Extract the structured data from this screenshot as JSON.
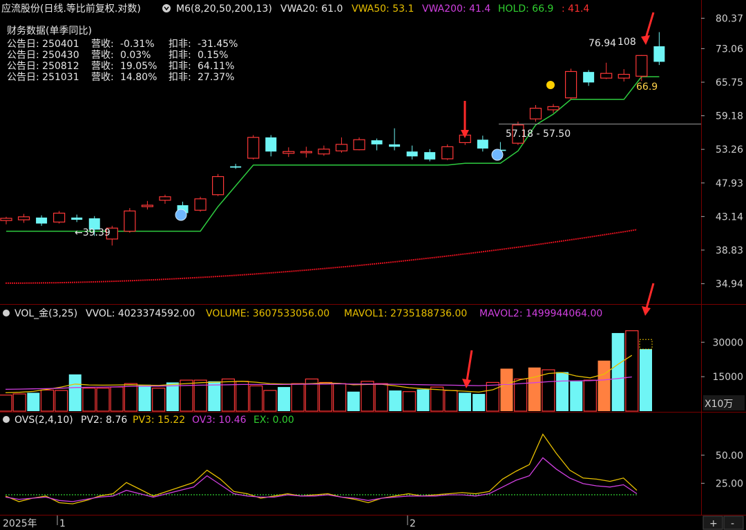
{
  "header": {
    "stock_name": "应流股份(日线.等比前复权.对数)",
    "indicator_name": "M6(8,20,50,200,13)",
    "indicators": [
      {
        "label": "VWA20: 61.0",
        "color": "#e8e8e8"
      },
      {
        "label": "VWA50: 53.1",
        "color": "#e8c000"
      },
      {
        "label": "VWA200: 41.4",
        "color": "#d040e0"
      },
      {
        "label": "HOLD: 66.9",
        "color": "#30d030"
      },
      {
        "label": ": 41.4",
        "color": "#ff3030"
      }
    ]
  },
  "fin_panel": {
    "title": "财务数据(单季同比)",
    "rows": [
      {
        "date": "公告日: 250401",
        "rev_label": "营收:",
        "rev": "-0.31%",
        "np_label": "扣非:",
        "np": "-31.45%"
      },
      {
        "date": "公告日: 250430",
        "rev_label": "营收:",
        "rev": "0.03%",
        "np_label": "扣非:",
        "np": "0.15%"
      },
      {
        "date": "公告日: 250812",
        "rev_label": "营收:",
        "rev": "19.05%",
        "np_label": "扣非:",
        "np": "64.11%"
      },
      {
        "date": "公告日: 251031",
        "rev_label": "营收:",
        "rev": "14.80%",
        "np_label": "扣非:",
        "np": "27.37%"
      }
    ]
  },
  "price_axis": [
    "80.37",
    "73.06",
    "65.75",
    "59.18",
    "53.26",
    "47.93",
    "43.14",
    "38.83",
    "34.94"
  ],
  "annotations": {
    "low": "←39.39",
    "high": "76.94",
    "high_suffix": "108",
    "range": "57.18 - 57.50",
    "hold": "66.9"
  },
  "vol_header": {
    "name": "VOL_金(3,25)",
    "items": [
      {
        "label": "VVOL: 4023374592.00",
        "color": "#e8e8e8"
      },
      {
        "label": "VOLUME: 3607533056.00",
        "color": "#e8c000"
      },
      {
        "label": "MAVOL1: 2735188736.00",
        "color": "#e8c000"
      },
      {
        "label": "MAVOL2: 1499944064.00",
        "color": "#d040e0"
      }
    ]
  },
  "vol_axis": [
    "30000",
    "15000"
  ],
  "vol_unit": "X10万",
  "ovs_header": {
    "name": "OVS(2,4,10)",
    "items": [
      {
        "label": "PV2: 8.76",
        "color": "#e8e8e8"
      },
      {
        "label": "PV3: 15.22",
        "color": "#e8c000"
      },
      {
        "label": "OV3: 10.46",
        "color": "#d040e0"
      },
      {
        "label": "EX: 0.00",
        "color": "#30d030"
      }
    ]
  },
  "ovs_axis": [
    "50.00",
    "25.00"
  ],
  "time_axis": {
    "year": "2025年",
    "m1": "1",
    "m2": "2"
  },
  "zoom": {
    "plus": "+",
    "minus": "-"
  },
  "colors": {
    "up": "#ff3838",
    "down": "#6ff5f5",
    "hold": "#2ecc40",
    "vwa200": "#e0101e",
    "vol_orange": "#ff8040"
  },
  "chart_data": [
    {
      "type": "candlestick",
      "title": "应流股份(日线.等比前复权.对数)",
      "scale": "log",
      "ylim": [
        33.5,
        84
      ],
      "candles": [
        {
          "o": 42.6,
          "h": 43.1,
          "l": 42.1,
          "c": 42.9
        },
        {
          "o": 42.7,
          "h": 43.5,
          "l": 42.3,
          "c": 43.1
        },
        {
          "o": 43.0,
          "h": 43.3,
          "l": 41.9,
          "c": 42.2
        },
        {
          "o": 42.4,
          "h": 43.9,
          "l": 42.2,
          "c": 43.6
        },
        {
          "o": 43.0,
          "h": 43.4,
          "l": 42.4,
          "c": 42.7
        },
        {
          "o": 42.9,
          "h": 43.2,
          "l": 40.6,
          "c": 41.4
        },
        {
          "o": 40.2,
          "h": 41.9,
          "l": 39.39,
          "c": 41.6
        },
        {
          "o": 41.2,
          "h": 44.3,
          "l": 41.0,
          "c": 43.9
        },
        {
          "o": 44.5,
          "h": 45.3,
          "l": 44.1,
          "c": 44.7
        },
        {
          "o": 45.4,
          "h": 46.2,
          "l": 44.9,
          "c": 45.9
        },
        {
          "o": 44.7,
          "h": 45.2,
          "l": 43.3,
          "c": 43.6
        },
        {
          "o": 44.0,
          "h": 45.9,
          "l": 43.8,
          "c": 45.6
        },
        {
          "o": 46.2,
          "h": 49.3,
          "l": 46.0,
          "c": 48.9
        },
        {
          "o": 50.5,
          "h": 50.9,
          "l": 50.1,
          "c": 50.3
        },
        {
          "o": 51.8,
          "h": 55.7,
          "l": 51.6,
          "c": 55.3
        },
        {
          "o": 55.3,
          "h": 55.7,
          "l": 52.1,
          "c": 52.9
        },
        {
          "o": 52.6,
          "h": 53.6,
          "l": 52.0,
          "c": 52.9
        },
        {
          "o": 52.7,
          "h": 53.7,
          "l": 51.9,
          "c": 52.9
        },
        {
          "o": 52.5,
          "h": 53.9,
          "l": 52.2,
          "c": 53.3
        },
        {
          "o": 53.0,
          "h": 55.3,
          "l": 52.7,
          "c": 54.1
        },
        {
          "o": 53.2,
          "h": 55.3,
          "l": 53.1,
          "c": 54.9
        },
        {
          "o": 54.8,
          "h": 55.1,
          "l": 53.1,
          "c": 54.1
        },
        {
          "o": 54.1,
          "h": 56.9,
          "l": 53.1,
          "c": 53.7
        },
        {
          "o": 52.9,
          "h": 53.9,
          "l": 51.6,
          "c": 52.1
        },
        {
          "o": 52.8,
          "h": 53.3,
          "l": 51.3,
          "c": 51.6
        },
        {
          "o": 51.7,
          "h": 54.1,
          "l": 51.5,
          "c": 53.7
        },
        {
          "o": 54.4,
          "h": 56.0,
          "l": 54.0,
          "c": 55.7
        },
        {
          "o": 54.9,
          "h": 55.6,
          "l": 52.9,
          "c": 53.4
        },
        {
          "o": 53.2,
          "h": 54.5,
          "l": 52.6,
          "c": 53.0
        },
        {
          "o": 54.3,
          "h": 58.1,
          "l": 54.0,
          "c": 57.5
        },
        {
          "o": 58.6,
          "h": 61.2,
          "l": 58.1,
          "c": 60.6
        },
        {
          "o": 60.3,
          "h": 61.4,
          "l": 59.7,
          "c": 60.9
        },
        {
          "o": 62.6,
          "h": 68.6,
          "l": 62.3,
          "c": 68.0
        },
        {
          "o": 67.9,
          "h": 68.3,
          "l": 65.0,
          "c": 65.7
        },
        {
          "o": 66.6,
          "h": 69.9,
          "l": 66.4,
          "c": 67.6
        },
        {
          "o": 66.6,
          "h": 68.5,
          "l": 65.9,
          "c": 67.4
        },
        {
          "o": 67.0,
          "h": 71.6,
          "l": 66.0,
          "c": 71.5
        },
        {
          "o": 73.6,
          "h": 76.94,
          "l": 69.4,
          "c": 70.1
        }
      ],
      "hold": [
        41.2,
        41.2,
        41.2,
        41.2,
        41.2,
        41.2,
        41.2,
        41.2,
        41.2,
        41.2,
        41.2,
        41.2,
        44.5,
        47.5,
        50.7,
        50.7,
        50.7,
        50.7,
        50.7,
        50.7,
        50.7,
        50.7,
        50.7,
        50.7,
        50.7,
        50.7,
        51.0,
        51.0,
        51.0,
        53.0,
        57.5,
        59.5,
        62.3,
        62.3,
        62.3,
        62.3,
        66.9,
        66.9
      ],
      "vwa200_start": 35.0,
      "vwa200_end": 41.4
    },
    {
      "type": "bar",
      "title": "VOL_金(3,25)",
      "unit": "X10万",
      "ylim": [
        0,
        40000
      ],
      "values": [
        7000,
        7500,
        8000,
        9200,
        9000,
        16000,
        10000,
        10000,
        10500,
        12000,
        11500,
        10000,
        12500,
        13500,
        13500,
        13000,
        14000,
        13000,
        11000,
        9000,
        10500,
        12000,
        14000,
        12500,
        12000,
        8500,
        13000,
        12000,
        9000,
        8500,
        9500,
        10500,
        9000,
        8000,
        7500,
        12500,
        18500,
        14000,
        19000,
        18000,
        17000,
        13000,
        13500,
        22000,
        34000,
        35000,
        27000
      ],
      "bull": [
        true,
        true,
        false,
        true,
        true,
        false,
        true,
        true,
        true,
        true,
        false,
        true,
        false,
        true,
        true,
        false,
        true,
        true,
        true,
        true,
        false,
        true,
        true,
        true,
        true,
        false,
        true,
        true,
        false,
        true,
        false,
        true,
        true,
        false,
        false,
        true,
        true,
        true,
        false,
        true,
        false,
        false,
        true,
        true,
        false,
        true,
        false
      ],
      "mavol1": [
        8000,
        8200,
        8600,
        9500,
        10500,
        11800,
        11400,
        11300,
        11400,
        11500,
        11300,
        11200,
        11600,
        12000,
        12400,
        12600,
        12800,
        13000,
        12600,
        12000,
        11800,
        11800,
        12000,
        12300,
        12100,
        11500,
        11600,
        11700,
        11000,
        10200,
        9700,
        9400,
        9000,
        8700,
        8300,
        9300,
        11800,
        13700,
        14800,
        16400,
        16800,
        15300,
        14500,
        16100,
        20400,
        24300
      ],
      "mavol2": [
        9500,
        9600,
        9700,
        9800,
        10000,
        10300,
        10400,
        10500,
        10600,
        10800,
        10900,
        10900,
        11000,
        11200,
        11300,
        11400,
        11500,
        11600,
        11600,
        11600,
        11600,
        11700,
        11800,
        11800,
        11900,
        11800,
        11800,
        11800,
        11700,
        11600,
        11500,
        11400,
        11300,
        11200,
        11100,
        11300,
        11600,
        12000,
        12400,
        12800,
        13100,
        13200,
        13300,
        13600,
        14200,
        14900
      ]
    },
    {
      "type": "line",
      "title": "OVS(2,4,10)",
      "ylim": [
        0,
        80
      ],
      "series": [
        {
          "name": "PV3",
          "values": [
            10,
            5,
            8,
            10,
            4,
            3,
            6,
            10,
            12,
            22,
            16,
            10,
            14,
            18,
            22,
            33,
            25,
            14,
            12,
            8,
            10,
            12,
            10,
            11,
            12,
            9,
            7,
            4,
            8,
            10,
            12,
            10,
            11,
            12,
            13,
            12,
            14,
            25,
            32,
            38,
            65,
            48,
            33,
            26,
            25,
            23,
            26,
            15
          ]
        },
        {
          "name": "OV3",
          "values": [
            9,
            7,
            8,
            9,
            6,
            5,
            7,
            9,
            10,
            15,
            12,
            9,
            12,
            15,
            18,
            28,
            20,
            12,
            10,
            9,
            9,
            11,
            10,
            10,
            11,
            9,
            8,
            6,
            8,
            9,
            10,
            10,
            10,
            11,
            11,
            10,
            12,
            18,
            24,
            28,
            44,
            34,
            26,
            21,
            19,
            18,
            20,
            12
          ]
        },
        {
          "name": "EX",
          "values": [
            0,
            0,
            0,
            0,
            0,
            0,
            0,
            0,
            0,
            0,
            0,
            0,
            0,
            0,
            0,
            0,
            0,
            0,
            0,
            0,
            0,
            0,
            0,
            0,
            0,
            0,
            0,
            0,
            0,
            0,
            0,
            0,
            0,
            0,
            0,
            0,
            0,
            0,
            0,
            0,
            0,
            0,
            0,
            0,
            0,
            0,
            0,
            0
          ]
        }
      ]
    }
  ]
}
